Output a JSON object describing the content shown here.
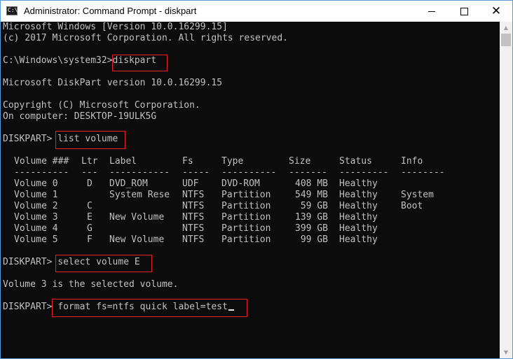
{
  "window": {
    "title": "Administrator: Command Prompt - diskpart",
    "icon": "console-icon",
    "icon_label": "C:\\",
    "controls": {
      "minimize": "minimize-icon",
      "maximize": "maximize-icon",
      "close": "close-icon",
      "close_glyph": "✕"
    }
  },
  "console": {
    "header_line1": "Microsoft Windows [Version 10.0.16299.15]",
    "header_line2": "(c) 2017 Microsoft Corporation. All rights reserved.",
    "prompt_path": "C:\\Windows\\system32>",
    "cmd1": "diskpart",
    "diskpart_version": "Microsoft DiskPart version 10.0.16299.15",
    "copyright": "Copyright (C) Microsoft Corporation.",
    "computer": "On computer: DESKTOP-19ULK5G",
    "diskpart_prompt": "DISKPART> ",
    "cmd2": "list volume",
    "cmd3": "select volume E",
    "selected_msg": "Volume 3 is the selected volume.",
    "cmd4": "format fs=ntfs quick label=test"
  },
  "volume_table": {
    "headers": {
      "volume": "Volume ###",
      "ltr": "Ltr",
      "label": "Label",
      "fs": "Fs",
      "type": "Type",
      "size": "Size",
      "status": "Status",
      "info": "Info"
    },
    "separators": {
      "volume": "----------",
      "ltr": "---",
      "label": "-----------",
      "fs": "-----",
      "type": "----------",
      "size": "-------",
      "status": "---------",
      "info": "--------"
    },
    "rows": [
      {
        "volume": "Volume 0",
        "ltr": "D",
        "label": "DVD_ROM",
        "fs": "UDF",
        "type": "DVD-ROM",
        "size": "408 MB",
        "status": "Healthy",
        "info": ""
      },
      {
        "volume": "Volume 1",
        "ltr": "",
        "label": "System Rese",
        "fs": "NTFS",
        "type": "Partition",
        "size": "549 MB",
        "status": "Healthy",
        "info": "System"
      },
      {
        "volume": "Volume 2",
        "ltr": "C",
        "label": "",
        "fs": "NTFS",
        "type": "Partition",
        "size": "59 GB",
        "status": "Healthy",
        "info": "Boot"
      },
      {
        "volume": "Volume 3",
        "ltr": "E",
        "label": "New Volume",
        "fs": "NTFS",
        "type": "Partition",
        "size": "139 GB",
        "status": "Healthy",
        "info": ""
      },
      {
        "volume": "Volume 4",
        "ltr": "G",
        "label": "",
        "fs": "NTFS",
        "type": "Partition",
        "size": "399 GB",
        "status": "Healthy",
        "info": ""
      },
      {
        "volume": "Volume 5",
        "ltr": "F",
        "label": "New Volume",
        "fs": "NTFS",
        "type": "Partition",
        "size": "99 GB",
        "status": "Healthy",
        "info": ""
      }
    ]
  },
  "scrollbar": {
    "up_icon": "scroll-up-arrow-icon",
    "down_icon": "scroll-down-arrow-icon",
    "up_glyph": "▲",
    "down_glyph": "▼"
  },
  "colors": {
    "console_bg": "#0c0c0c",
    "console_text": "#c0c0c0",
    "highlight": "#e8202a",
    "window_border": "#5a9ad8"
  }
}
